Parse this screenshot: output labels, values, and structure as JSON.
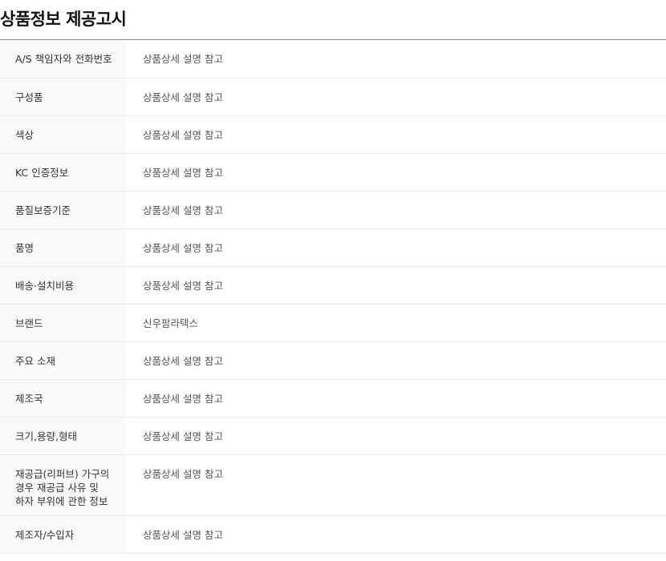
{
  "title": "상품정보 제공고시",
  "rows": [
    {
      "label": "A/S 책임자와 전화번호",
      "value": "상품상세 설명 참고"
    },
    {
      "label": "구성품",
      "value": "상품상세 설명 참고"
    },
    {
      "label": "색상",
      "value": "상품상세 설명 참고"
    },
    {
      "label": "KC 인증정보",
      "value": "상품상세 설명 참고"
    },
    {
      "label": "품질보증기준",
      "value": "상품상세 설명 참고"
    },
    {
      "label": "품명",
      "value": "상품상세 설명 참고"
    },
    {
      "label": "배송·설치비용",
      "value": "상품상세 설명 참고"
    },
    {
      "label": "브랜드",
      "value": "신우팜라텍스"
    },
    {
      "label": "주요 소재",
      "value": "상품상세 설명 참고"
    },
    {
      "label": "제조국",
      "value": "상품상세 설명 참고"
    },
    {
      "label": "크기,용량,형태",
      "value": "상품상세 설명 참고"
    },
    {
      "label": "재공급(리퍼브) 가구의 경우 재공급 사유 및 하자 부위에 관한 정보",
      "value": "상품상세 설명 참고"
    },
    {
      "label": "제조자/수입자",
      "value": "상품상세 설명 참고"
    }
  ]
}
